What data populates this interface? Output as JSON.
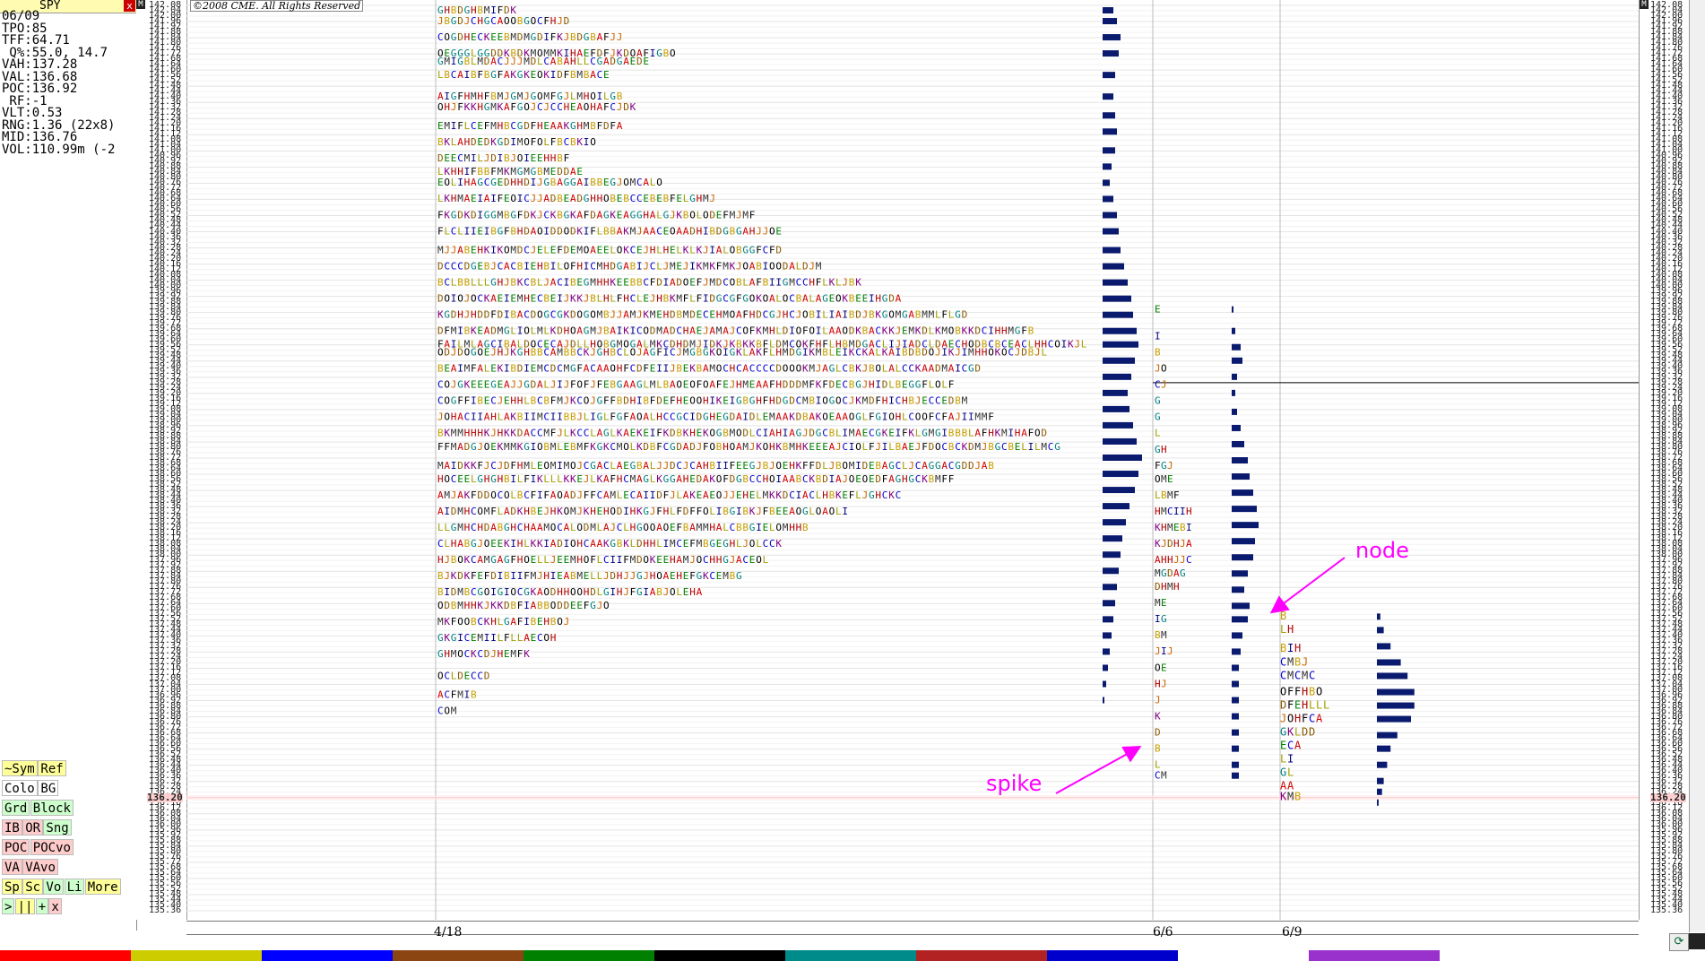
{
  "panel": {
    "symbol": "SPY",
    "close_label": "x",
    "stats": [
      "06/09",
      "TPO:85",
      "TFF:64.71",
      " Q%:55.0, 14.7",
      "VAH:137.28",
      "VAL:136.68",
      "POC:136.92",
      " RF:-1",
      "VLT:0.53",
      "RNG:1.36 (22x8)",
      "MID:136.76",
      "VOL:110.99m (-2"
    ],
    "buttons": [
      {
        "id": "symref-a",
        "label": "~Sym",
        "color": "#ffff99",
        "row": 0
      },
      {
        "id": "symref-b",
        "label": "Ref",
        "color": "#ffff99",
        "row": 0
      },
      {
        "id": "colo",
        "label": "Colo",
        "color": "#ffffff",
        "row": 1
      },
      {
        "id": "bg",
        "label": "BG",
        "color": "#ffffff",
        "row": 1
      },
      {
        "id": "grd",
        "label": "Grd",
        "color": "#ccffcc",
        "row": 2
      },
      {
        "id": "block",
        "label": "Block",
        "color": "#ccffcc",
        "row": 2
      },
      {
        "id": "ib",
        "label": "IB",
        "color": "#ffcccc",
        "row": 3
      },
      {
        "id": "or",
        "label": "OR",
        "color": "#ffcccc",
        "row": 3
      },
      {
        "id": "sng",
        "label": "Sng",
        "color": "#ccffcc",
        "row": 3
      },
      {
        "id": "poc",
        "label": "POC",
        "color": "#ffcccc",
        "row": 4
      },
      {
        "id": "pocvo",
        "label": "POCvo",
        "color": "#ffcccc",
        "row": 4
      },
      {
        "id": "va",
        "label": "VA",
        "color": "#ffcccc",
        "row": 5
      },
      {
        "id": "vavo",
        "label": "VAvo",
        "color": "#ffcccc",
        "row": 5
      },
      {
        "id": "sp",
        "label": "Sp",
        "color": "#ffff99",
        "row": 6
      },
      {
        "id": "sc",
        "label": "Sc",
        "color": "#ffff99",
        "row": 6
      },
      {
        "id": "vo",
        "label": "Vo",
        "color": "#ccffcc",
        "row": 6
      },
      {
        "id": "li",
        "label": "Li",
        "color": "#ccffcc",
        "row": 6
      },
      {
        "id": "more",
        "label": "More",
        "color": "#ffff99",
        "row": 6
      },
      {
        "id": "nav-next",
        "label": ">",
        "color": "#ccffcc",
        "row": 7
      },
      {
        "id": "nav-bars",
        "label": "||",
        "color": "#ffff99",
        "row": 7
      },
      {
        "id": "nav-plus",
        "label": "+",
        "color": "#ccffcc",
        "row": 7
      },
      {
        "id": "nav-close",
        "label": "x",
        "color": "#ffcccc",
        "row": 7
      }
    ]
  },
  "copyright": "©2008 CME. All Rights Reserved",
  "annotations": {
    "spike": "spike",
    "node": "node"
  },
  "axis_mark": "M",
  "chart_data": {
    "type": "market-profile",
    "price_axis": {
      "min": 135.36,
      "max": 142.08,
      "step": 0.04
    },
    "current_price": 136.2,
    "current_price_label": "136.20",
    "crosshair_price": 139.28,
    "dates": [
      "4/18",
      "6/6",
      "6/9"
    ],
    "tpo_letters": [
      "A",
      "B",
      "C",
      "D",
      "E",
      "F",
      "G",
      "H",
      "I",
      "J",
      "K",
      "L",
      "M",
      "O"
    ],
    "letter_colors": {
      "A": "#d00000",
      "B": "#c8a000",
      "C": "#0000cc",
      "D": "#8a5a00",
      "E": "#008000",
      "F": "#000000",
      "G": "#008080",
      "H": "#b00000",
      "I": "#000080",
      "J": "#cc6600",
      "K": "#800080",
      "L": "#a0a000",
      "M": "#303030",
      "O": "#000000"
    },
    "profiles": [
      {
        "name": "4/18",
        "type": "composite",
        "tpo_counts": [
          [
            142.04,
            12
          ],
          [
            141.96,
            20
          ],
          [
            141.84,
            28
          ],
          [
            141.72,
            36
          ],
          [
            141.66,
            32
          ],
          [
            141.56,
            26
          ],
          [
            141.4,
            28
          ],
          [
            141.32,
            30
          ],
          [
            141.18,
            28
          ],
          [
            141.06,
            24
          ],
          [
            140.94,
            20
          ],
          [
            140.84,
            22
          ],
          [
            140.76,
            34
          ],
          [
            140.64,
            42
          ],
          [
            140.52,
            48
          ],
          [
            140.4,
            52
          ],
          [
            140.26,
            52
          ],
          [
            140.14,
            58
          ],
          [
            140.02,
            64
          ],
          [
            139.9,
            70
          ],
          [
            139.78,
            80
          ],
          [
            139.66,
            90
          ],
          [
            139.56,
            98
          ],
          [
            139.5,
            92
          ],
          [
            139.38,
            82
          ],
          [
            139.26,
            78
          ],
          [
            139.14,
            80
          ],
          [
            139.02,
            84
          ],
          [
            138.9,
            92
          ],
          [
            138.8,
            94
          ],
          [
            138.66,
            84
          ],
          [
            138.56,
            78
          ],
          [
            138.44,
            70
          ],
          [
            138.32,
            62
          ],
          [
            138.2,
            56
          ],
          [
            138.08,
            52
          ],
          [
            137.96,
            50
          ],
          [
            137.84,
            46
          ],
          [
            137.72,
            40
          ],
          [
            137.62,
            26
          ],
          [
            137.5,
            20
          ],
          [
            137.38,
            18
          ],
          [
            137.26,
            14
          ],
          [
            137.1,
            8
          ],
          [
            136.96,
            6
          ],
          [
            136.84,
            3
          ]
        ],
        "volume": [
          [
            142.04,
            12
          ],
          [
            141.96,
            16
          ],
          [
            141.84,
            20
          ],
          [
            141.72,
            18
          ],
          [
            141.56,
            14
          ],
          [
            141.4,
            12
          ],
          [
            141.26,
            14
          ],
          [
            141.14,
            16
          ],
          [
            141.0,
            14
          ],
          [
            140.88,
            10
          ],
          [
            140.76,
            8
          ],
          [
            140.64,
            12
          ],
          [
            140.52,
            16
          ],
          [
            140.4,
            18
          ],
          [
            140.26,
            20
          ],
          [
            140.14,
            24
          ],
          [
            140.02,
            28
          ],
          [
            139.9,
            32
          ],
          [
            139.78,
            34
          ],
          [
            139.66,
            38
          ],
          [
            139.56,
            40
          ],
          [
            139.44,
            36
          ],
          [
            139.32,
            32
          ],
          [
            139.2,
            28
          ],
          [
            139.08,
            30
          ],
          [
            138.96,
            34
          ],
          [
            138.84,
            38
          ],
          [
            138.72,
            44
          ],
          [
            138.6,
            40
          ],
          [
            138.48,
            36
          ],
          [
            138.36,
            30
          ],
          [
            138.24,
            26
          ],
          [
            138.12,
            22
          ],
          [
            138.0,
            20
          ],
          [
            137.88,
            18
          ],
          [
            137.76,
            16
          ],
          [
            137.64,
            14
          ],
          [
            137.52,
            12
          ],
          [
            137.4,
            10
          ],
          [
            137.28,
            8
          ],
          [
            137.16,
            6
          ],
          [
            137.04,
            4
          ],
          [
            136.92,
            2
          ]
        ]
      },
      {
        "name": "6/6",
        "type": "day",
        "tpo_counts": [
          [
            139.82,
            1
          ],
          [
            139.62,
            1
          ],
          [
            139.5,
            1
          ],
          [
            139.38,
            2
          ],
          [
            139.26,
            2
          ],
          [
            139.14,
            1
          ],
          [
            139.02,
            1
          ],
          [
            138.9,
            1
          ],
          [
            138.78,
            2
          ],
          [
            138.66,
            3
          ],
          [
            138.56,
            3
          ],
          [
            138.44,
            4
          ],
          [
            138.32,
            6
          ],
          [
            138.2,
            6
          ],
          [
            138.08,
            6
          ],
          [
            137.96,
            6
          ],
          [
            137.86,
            5
          ],
          [
            137.76,
            4
          ],
          [
            137.64,
            2
          ],
          [
            137.52,
            2
          ],
          [
            137.4,
            2
          ],
          [
            137.28,
            3
          ],
          [
            137.16,
            2
          ],
          [
            137.04,
            2
          ],
          [
            136.92,
            1
          ],
          [
            136.8,
            1
          ],
          [
            136.68,
            1
          ],
          [
            136.56,
            1
          ],
          [
            136.44,
            1
          ],
          [
            136.36,
            2
          ]
        ],
        "volume": [
          [
            139.82,
            2
          ],
          [
            139.66,
            4
          ],
          [
            139.54,
            10
          ],
          [
            139.44,
            12
          ],
          [
            139.32,
            6
          ],
          [
            139.2,
            4
          ],
          [
            139.06,
            6
          ],
          [
            138.94,
            10
          ],
          [
            138.82,
            14
          ],
          [
            138.7,
            18
          ],
          [
            138.58,
            20
          ],
          [
            138.46,
            24
          ],
          [
            138.34,
            28
          ],
          [
            138.22,
            30
          ],
          [
            138.1,
            26
          ],
          [
            137.98,
            24
          ],
          [
            137.86,
            18
          ],
          [
            137.74,
            14
          ],
          [
            137.62,
            20
          ],
          [
            137.52,
            18
          ],
          [
            137.4,
            12
          ],
          [
            137.28,
            10
          ],
          [
            137.16,
            8
          ],
          [
            137.04,
            8
          ],
          [
            136.92,
            8
          ],
          [
            136.8,
            8
          ],
          [
            136.68,
            8
          ],
          [
            136.56,
            8
          ],
          [
            136.44,
            8
          ],
          [
            136.36,
            8
          ]
        ]
      },
      {
        "name": "6/9",
        "type": "day",
        "tpo_counts": [
          [
            137.54,
            1
          ],
          [
            137.44,
            2
          ],
          [
            137.3,
            3
          ],
          [
            137.2,
            4
          ],
          [
            137.1,
            5
          ],
          [
            136.98,
            6
          ],
          [
            136.88,
            7
          ],
          [
            136.78,
            6
          ],
          [
            136.68,
            5
          ],
          [
            136.58,
            3
          ],
          [
            136.48,
            2
          ],
          [
            136.38,
            2
          ],
          [
            136.28,
            2
          ],
          [
            136.2,
            3
          ]
        ],
        "volume": [
          [
            137.54,
            2
          ],
          [
            137.44,
            4
          ],
          [
            137.32,
            8
          ],
          [
            137.2,
            14
          ],
          [
            137.1,
            18
          ],
          [
            136.98,
            22
          ],
          [
            136.88,
            22
          ],
          [
            136.78,
            20
          ],
          [
            136.66,
            12
          ],
          [
            136.56,
            8
          ],
          [
            136.44,
            6
          ],
          [
            136.32,
            4
          ],
          [
            136.24,
            3
          ],
          [
            136.16,
            1
          ]
        ]
      }
    ]
  }
}
